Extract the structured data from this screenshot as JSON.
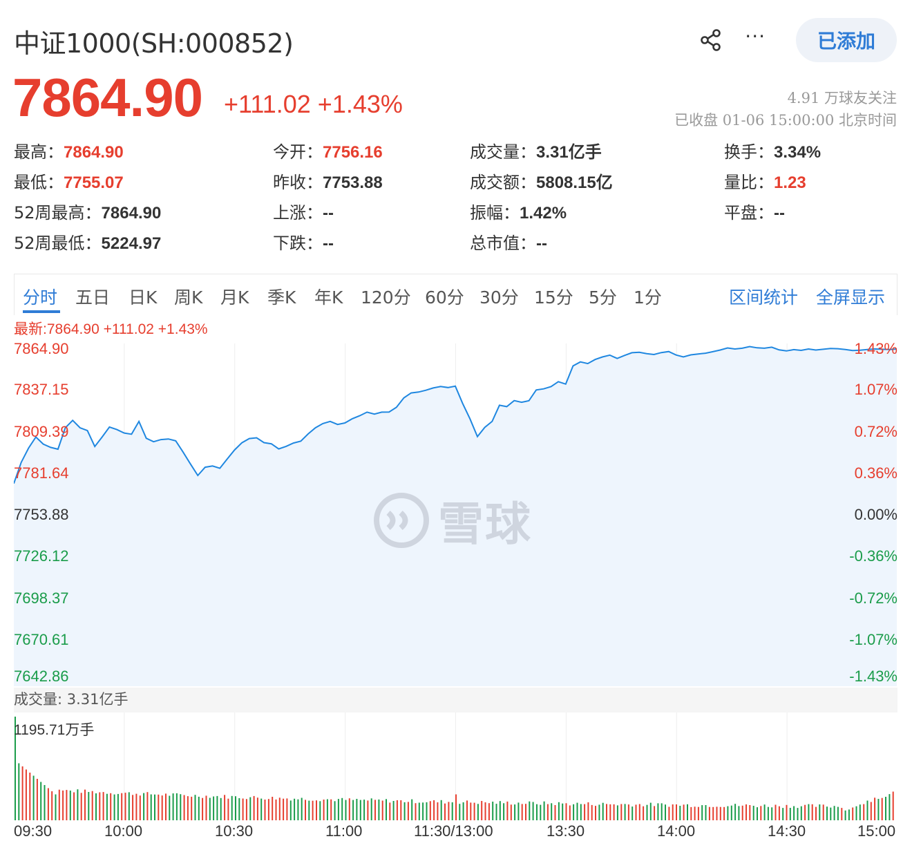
{
  "header": {
    "title": "中证1000(SH:000852)",
    "added_label": "已添加",
    "more_label": "···"
  },
  "quote": {
    "price": "7864.90",
    "change": "+111.02 +1.43%",
    "followers": "4.91 万球友关注",
    "status": "已收盘 01-06 15:00:00 北京时间"
  },
  "stats": [
    {
      "k": "最高：",
      "v": "7864.90",
      "color": "red"
    },
    {
      "k": "今开：",
      "v": "7756.16",
      "color": "red"
    },
    {
      "k": "成交量：",
      "v": "3.31亿手",
      "color": "dark"
    },
    {
      "k": "换手：",
      "v": "3.34%",
      "color": "dark"
    },
    {
      "k": "最低：",
      "v": "7755.07",
      "color": "red"
    },
    {
      "k": "昨收：",
      "v": "7753.88",
      "color": "dark"
    },
    {
      "k": "成交额：",
      "v": "5808.15亿",
      "color": "dark"
    },
    {
      "k": "量比：",
      "v": "1.23",
      "color": "red"
    },
    {
      "k": "52周最高：",
      "v": "7864.90",
      "color": "dark"
    },
    {
      "k": "上涨：",
      "v": "--",
      "color": "dark"
    },
    {
      "k": "振幅：",
      "v": "1.42%",
      "color": "dark"
    },
    {
      "k": "平盘：",
      "v": "--",
      "color": "dark"
    },
    {
      "k": "52周最低：",
      "v": "5224.97",
      "color": "dark"
    },
    {
      "k": "下跌：",
      "v": "--",
      "color": "dark"
    },
    {
      "k": "总市值：",
      "v": "--",
      "color": "dark"
    }
  ],
  "tabs": [
    "分时",
    "五日",
    "日K",
    "周K",
    "月K",
    "季K",
    "年K",
    "120分",
    "60分",
    "30分",
    "15分",
    "5分",
    "1分"
  ],
  "tools": [
    "区间统计",
    "全屏显示"
  ],
  "latest": "最新:7864.90 +111.02 +1.43%",
  "watermark": "雪球",
  "volume_label": "成交量: 3.31亿手",
  "volume_max": "1195.71万手",
  "colors": {
    "up": "#e63e2e",
    "down": "#1a9c4a",
    "accent": "#2f7cd6",
    "line": "#1f87e0"
  },
  "chart_data": {
    "type": "line",
    "title": "",
    "prev_close": 7753.88,
    "ylim": [
      7642.86,
      7864.9
    ],
    "y_ticks_left": [
      "7864.90",
      "7837.15",
      "7809.39",
      "7781.64",
      "7753.88",
      "7726.12",
      "7698.37",
      "7670.61",
      "7642.86"
    ],
    "y_ticks_right": [
      "1.43%",
      "1.07%",
      "0.72%",
      "0.36%",
      "0.00%",
      "-0.36%",
      "-0.72%",
      "-1.07%",
      "-1.43%"
    ],
    "x_ticks": [
      "09:30",
      "10:00",
      "10:30",
      "11:00",
      "11:30/13:00",
      "13:30",
      "14:00",
      "14:30",
      "15:00"
    ],
    "series": [
      {
        "x": [
          "09:30",
          "09:32",
          "09:34",
          "09:36",
          "09:38",
          "09:40",
          "09:42",
          "09:44",
          "09:46",
          "09:48",
          "09:50",
          "09:52",
          "09:54",
          "09:56",
          "09:58",
          "10:00",
          "10:02",
          "10:04",
          "10:06",
          "10:08",
          "10:10",
          "10:12",
          "10:14",
          "10:16",
          "10:18",
          "10:20",
          "10:22",
          "10:24",
          "10:26",
          "10:28",
          "10:30",
          "10:32",
          "10:34",
          "10:36",
          "10:38",
          "10:40",
          "10:42",
          "10:44",
          "10:46",
          "10:48",
          "10:50",
          "10:52",
          "10:54",
          "10:56",
          "10:58",
          "11:00",
          "11:02",
          "11:04",
          "11:06",
          "11:08",
          "11:10",
          "11:12",
          "11:14",
          "11:16",
          "11:18",
          "11:20",
          "11:22",
          "11:24",
          "11:26",
          "11:28",
          "11:30",
          "13:02",
          "13:04",
          "13:06",
          "13:08",
          "13:10",
          "13:12",
          "13:14",
          "13:16",
          "13:18",
          "13:20",
          "13:22",
          "13:24",
          "13:26",
          "13:28",
          "13:30",
          "13:32",
          "13:34",
          "13:36",
          "13:38",
          "13:40",
          "13:42",
          "13:44",
          "13:46",
          "13:48",
          "13:50",
          "13:52",
          "13:54",
          "13:56",
          "13:58",
          "14:00",
          "14:02",
          "14:04",
          "14:06",
          "14:08",
          "14:10",
          "14:12",
          "14:14",
          "14:16",
          "14:18",
          "14:20",
          "14:22",
          "14:24",
          "14:26",
          "14:28",
          "14:30",
          "14:32",
          "14:34",
          "14:36",
          "14:38",
          "14:40",
          "14:42",
          "14:44",
          "14:46",
          "14:48",
          "14:50",
          "14:52",
          "14:54",
          "14:56",
          "14:58",
          "15:00"
        ],
        "values": [
          7775.2,
          7789.3,
          7798.8,
          7806.2,
          7801.5,
          7799.3,
          7798.1,
          7812.4,
          7817.3,
          7812.4,
          7810.5,
          7799.9,
          7806.2,
          7812.9,
          7811.2,
          7808.9,
          7808.1,
          7816.6,
          7805.4,
          7803.1,
          7804.5,
          7804.9,
          7803.7,
          7796.2,
          7788.3,
          7780.6,
          7786.1,
          7786.9,
          7785.4,
          7791.6,
          7797.6,
          7802.4,
          7805.2,
          7805.7,
          7802.5,
          7801.7,
          7798.3,
          7800.0,
          7802.2,
          7803.5,
          7808.3,
          7812.4,
          7815.2,
          7816.6,
          7814.6,
          7815.6,
          7818.4,
          7820.4,
          7822.8,
          7821.5,
          7822.8,
          7822.9,
          7826.0,
          7832.3,
          7835.6,
          7836.2,
          7837.4,
          7838.9,
          7839.9,
          7839.2,
          7840.1,
          7828.6,
          7818.3,
          7806.5,
          7812.6,
          7816.6,
          7827.4,
          7826.5,
          7830.5,
          7829.4,
          7830.4,
          7837.6,
          7838.3,
          7839.8,
          7843.1,
          7841.5,
          7853.6,
          7856.3,
          7855.2,
          7857.9,
          7859.6,
          7860.8,
          7858.6,
          7860.6,
          7862.4,
          7862.7,
          7861.8,
          7861.2,
          7862.5,
          7863.2,
          7860.9,
          7859.6,
          7861.0,
          7861.6,
          7862.1,
          7863.1,
          7864.2,
          7865.6,
          7864.9,
          7865.4,
          7866.5,
          7865.7,
          7865.4,
          7866.1,
          7864.3,
          7863.6,
          7864.5,
          7864.0,
          7864.9,
          7864.2,
          7864.7,
          7865.2,
          7865.1,
          7864.6,
          7863.9,
          7864.1,
          7864.6,
          7864.9,
          7864.7,
          7864.6,
          7864.9
        ]
      }
    ],
    "volume": {
      "unit": "万手",
      "max": 1195.71
    }
  }
}
